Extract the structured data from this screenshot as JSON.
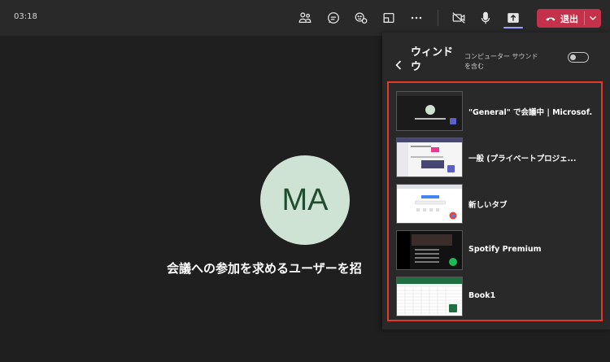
{
  "topbar": {
    "time": "03:18",
    "icons": [
      "people-icon",
      "chat-icon",
      "reactions-icon",
      "view-icon",
      "more-icon",
      "camera-off-icon",
      "mic-icon",
      "share-screen-icon"
    ],
    "leave_label": "退出"
  },
  "stage": {
    "avatar_initials": "MA",
    "invite_text": "会議への参加を求めるユーザーを招"
  },
  "panel": {
    "title": "ウィンドウ",
    "computer_sound_label": "コンピューター サウンドを含む",
    "windows": [
      {
        "label": "\"General\" で会議中 | Microsof..."
      },
      {
        "label": "一般 (プライベートプロジェ..."
      },
      {
        "label": "新しいタブ"
      },
      {
        "label": "Spotify Premium"
      },
      {
        "label": "Book1"
      }
    ]
  },
  "colors": {
    "accent": "#9ea2ff",
    "leave": "#c4314b",
    "highlight_border": "#e03a2a"
  }
}
